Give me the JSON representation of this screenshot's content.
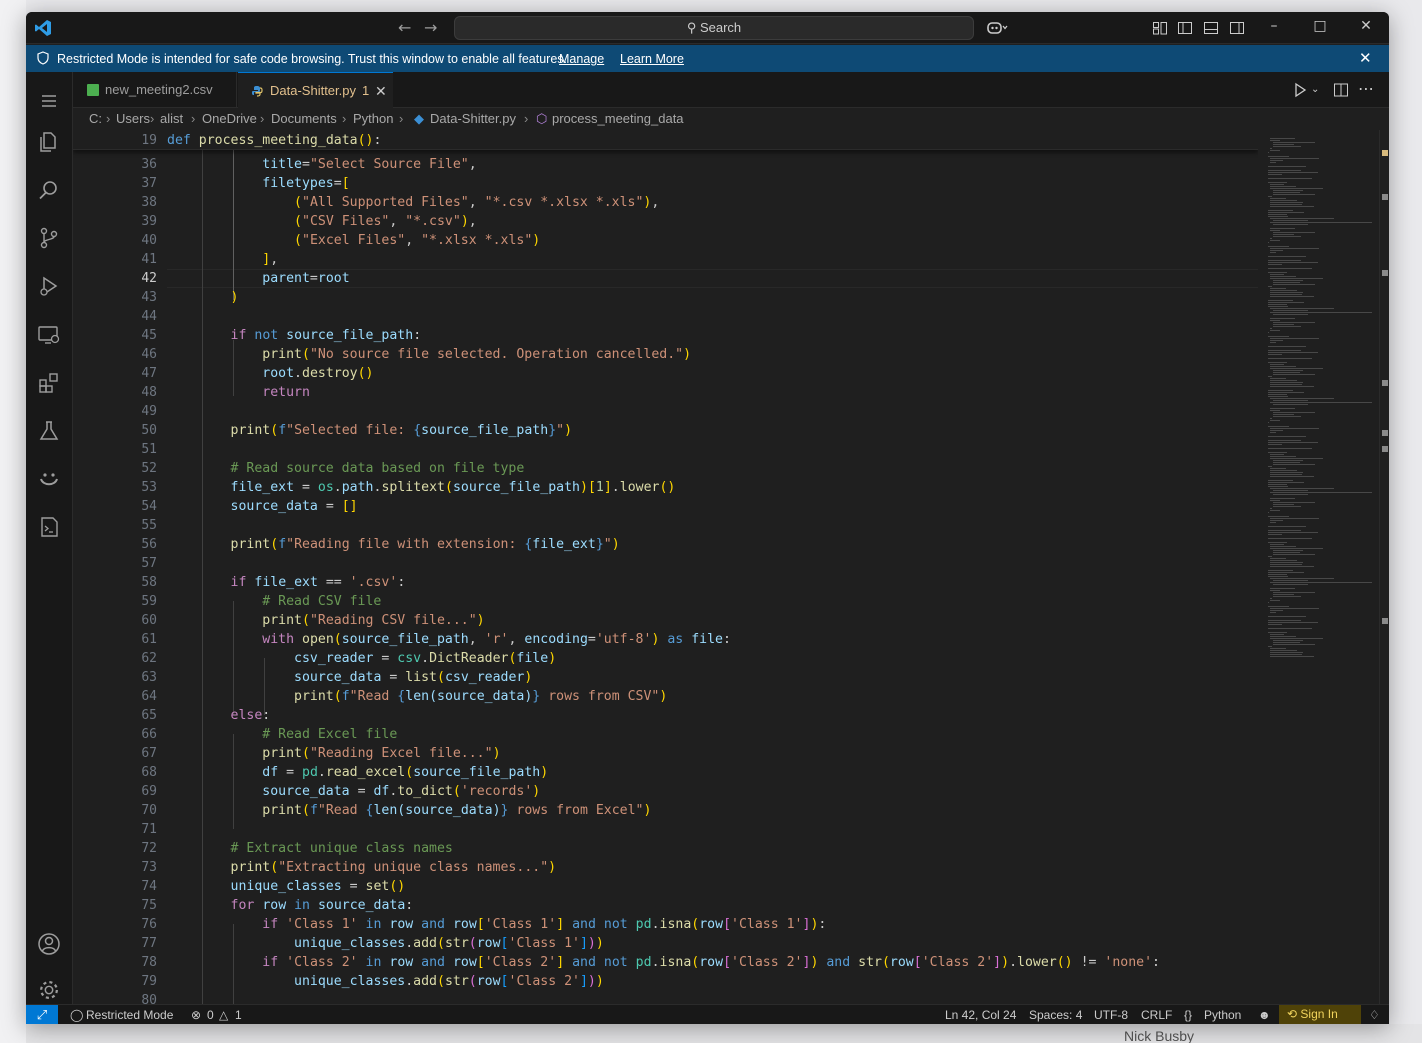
{
  "window": {
    "search_label": "Search",
    "banner": {
      "message": "Restricted Mode is intended for safe code browsing. Trust this window to enable all features.",
      "manage": "Manage",
      "learn_more": "Learn More"
    },
    "tabs": [
      {
        "label": "new_meeting2.csv",
        "icon": "csv-file-icon"
      },
      {
        "label": "Data-Shitter.py",
        "badge": "1",
        "icon": "python-file-icon",
        "active": true
      }
    ],
    "breadcrumb": [
      "C:",
      "Users",
      "alist",
      "OneDrive",
      "Documents",
      "Python",
      "Data-Shitter.py",
      "process_meeting_data"
    ],
    "sticky": {
      "line": "19",
      "code": "def process_meeting_data():"
    }
  },
  "editor": {
    "active_line": "42",
    "lines": [
      {
        "n": "36",
        "code": "            title=\"Select Source File\","
      },
      {
        "n": "37",
        "code": "            filetypes=["
      },
      {
        "n": "38",
        "code": "                (\"All Supported Files\", \"*.csv *.xlsx *.xls\"),"
      },
      {
        "n": "39",
        "code": "                (\"CSV Files\", \"*.csv\"),"
      },
      {
        "n": "40",
        "code": "                (\"Excel Files\", \"*.xlsx *.xls\")"
      },
      {
        "n": "41",
        "code": "            ],"
      },
      {
        "n": "42",
        "code": "            parent=root"
      },
      {
        "n": "43",
        "code": "        )"
      },
      {
        "n": "44",
        "code": ""
      },
      {
        "n": "45",
        "code": "        if not source_file_path:"
      },
      {
        "n": "46",
        "code": "            print(\"No source file selected. Operation cancelled.\")"
      },
      {
        "n": "47",
        "code": "            root.destroy()"
      },
      {
        "n": "48",
        "code": "            return"
      },
      {
        "n": "49",
        "code": ""
      },
      {
        "n": "50",
        "code": "        print(f\"Selected file: {source_file_path}\")"
      },
      {
        "n": "51",
        "code": ""
      },
      {
        "n": "52",
        "code": "        # Read source data based on file type"
      },
      {
        "n": "53",
        "code": "        file_ext = os.path.splitext(source_file_path)[1].lower()"
      },
      {
        "n": "54",
        "code": "        source_data = []"
      },
      {
        "n": "55",
        "code": ""
      },
      {
        "n": "56",
        "code": "        print(f\"Reading file with extension: {file_ext}\")"
      },
      {
        "n": "57",
        "code": ""
      },
      {
        "n": "58",
        "code": "        if file_ext == '.csv':"
      },
      {
        "n": "59",
        "code": "            # Read CSV file"
      },
      {
        "n": "60",
        "code": "            print(\"Reading CSV file...\")"
      },
      {
        "n": "61",
        "code": "            with open(source_file_path, 'r', encoding='utf-8') as file:"
      },
      {
        "n": "62",
        "code": "                csv_reader = csv.DictReader(file)"
      },
      {
        "n": "63",
        "code": "                source_data = list(csv_reader)"
      },
      {
        "n": "64",
        "code": "                print(f\"Read {len(source_data)} rows from CSV\")"
      },
      {
        "n": "65",
        "code": "        else:"
      },
      {
        "n": "66",
        "code": "            # Read Excel file"
      },
      {
        "n": "67",
        "code": "            print(\"Reading Excel file...\")"
      },
      {
        "n": "68",
        "code": "            df = pd.read_excel(source_file_path)"
      },
      {
        "n": "69",
        "code": "            source_data = df.to_dict('records')"
      },
      {
        "n": "70",
        "code": "            print(f\"Read {len(source_data)} rows from Excel\")"
      },
      {
        "n": "71",
        "code": ""
      },
      {
        "n": "72",
        "code": "        # Extract unique class names"
      },
      {
        "n": "73",
        "code": "        print(\"Extracting unique class names...\")"
      },
      {
        "n": "74",
        "code": "        unique_classes = set()"
      },
      {
        "n": "75",
        "code": "        for row in source_data:"
      },
      {
        "n": "76",
        "code": "            if 'Class 1' in row and row['Class 1'] and not pd.isna(row['Class 1']):"
      },
      {
        "n": "77",
        "code": "                unique_classes.add(str(row['Class 1']))"
      },
      {
        "n": "78",
        "code": "            if 'Class 2' in row and row['Class 2'] and not pd.isna(row['Class 2']) and str(row['Class 2']).lower() != 'none':"
      },
      {
        "n": "79",
        "code": "                unique_classes.add(str(row['Class 2']))"
      },
      {
        "n": "80",
        "code": ""
      }
    ]
  },
  "status": {
    "mode": "Restricted Mode",
    "errors": "0",
    "warnings": "1",
    "position": "Ln 42, Col 24",
    "spaces": "Spaces: 4",
    "encoding": "UTF-8",
    "eol": "CRLF",
    "language": "Python",
    "sign_in": "Sign In"
  },
  "desktop": {
    "name": "Nick Busby"
  },
  "colors": {
    "accent": "#0078d4",
    "banner": "#0e4a75",
    "editor_bg": "#1f1f1f",
    "chrome_bg": "#181818"
  }
}
